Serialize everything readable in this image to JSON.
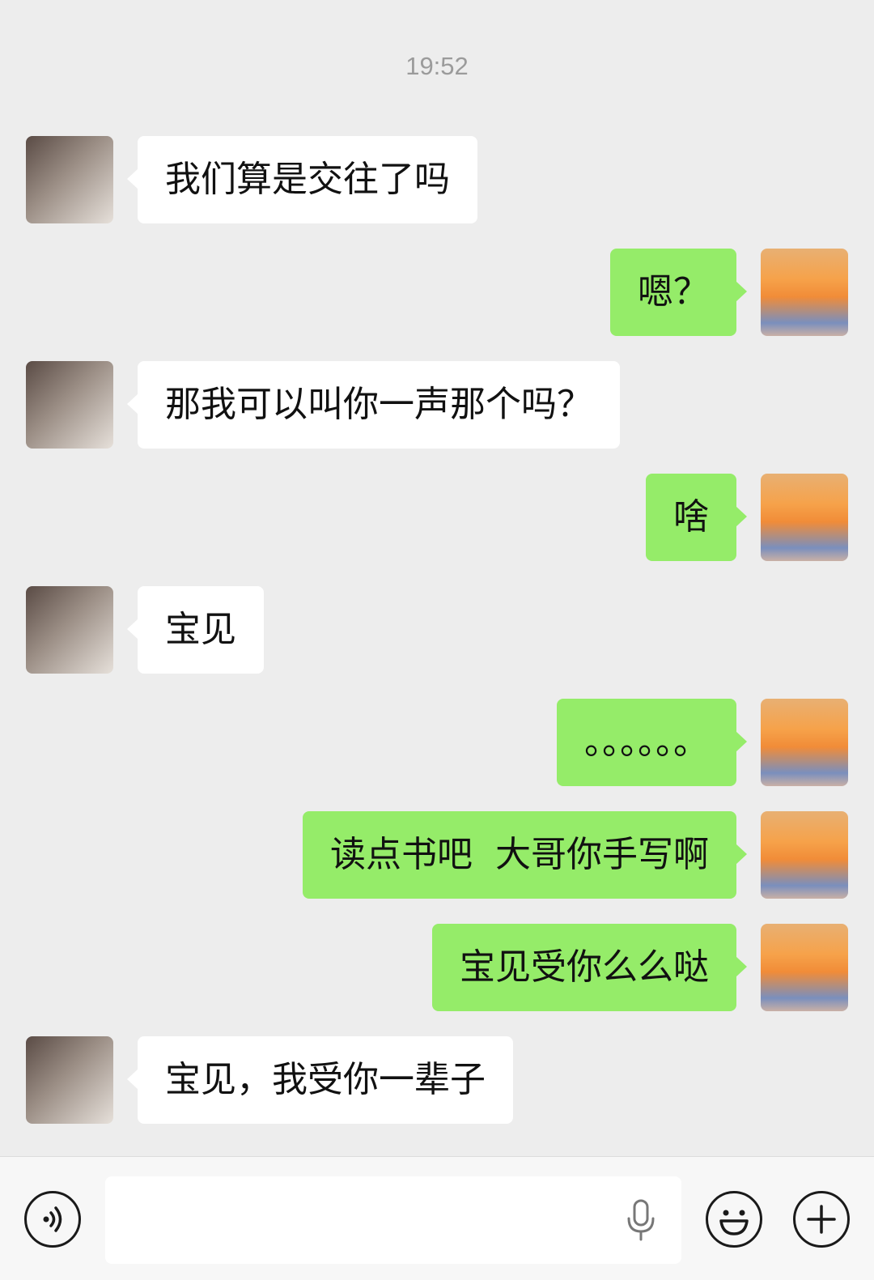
{
  "chat": {
    "timestamp": "19:52",
    "messages": [
      {
        "side": "in",
        "text": "我们算是交往了吗"
      },
      {
        "side": "out",
        "text": "嗯？"
      },
      {
        "side": "in",
        "text": "那我可以叫你一声那个吗？"
      },
      {
        "side": "out",
        "text": "啥"
      },
      {
        "side": "in",
        "text": "宝见"
      },
      {
        "side": "out",
        "text": "。。。。。。"
      },
      {
        "side": "out",
        "text": "读点书吧  大哥你手写啊"
      },
      {
        "side": "out",
        "text": "宝见受你么么哒"
      },
      {
        "side": "in",
        "text": "宝见，我受你一辈子"
      }
    ]
  },
  "input_bar": {
    "value": "",
    "placeholder": "",
    "icons": {
      "voice": "voice-icon",
      "mic": "microphone-icon",
      "emoji": "emoji-icon",
      "plus": "plus-icon"
    }
  },
  "colors": {
    "background": "#ededed",
    "incoming_bubble": "#ffffff",
    "outgoing_bubble": "#95ec69",
    "timestamp": "#9b9b9b"
  }
}
